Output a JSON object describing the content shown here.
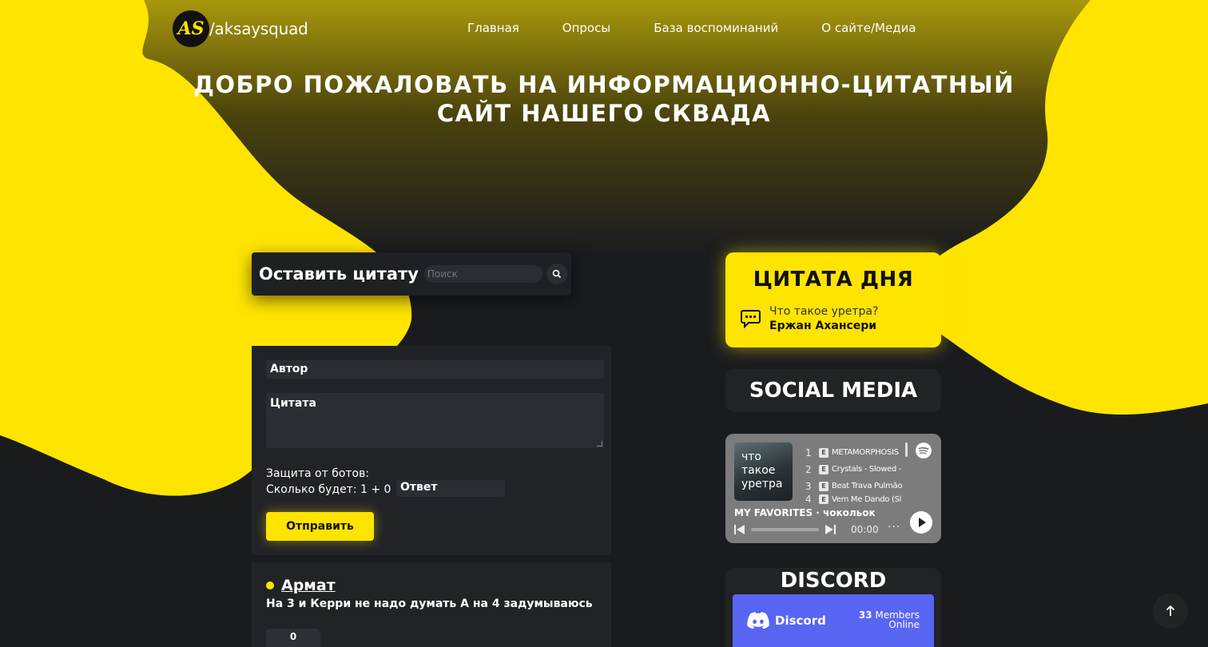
{
  "brand": {
    "logo_mark": "AS",
    "name": "/aksaysquad"
  },
  "nav": {
    "items": [
      {
        "label": "Главная"
      },
      {
        "label": "Опросы"
      },
      {
        "label": "База воспоминаний"
      },
      {
        "label": "О сайте/Медиа"
      }
    ]
  },
  "hero": {
    "title_line1": "ДОБРО ПОЖАЛОВАТЬ НА ИНФОРМАЦИОННО-ЦИТАТНЫЙ",
    "title_line2": "САЙТ НАШЕГО СКВАДА"
  },
  "quote_form": {
    "title": "Оставить цитату",
    "search_placeholder": "Поиск",
    "author_placeholder": "Автор",
    "quote_placeholder": "Цитата",
    "bot_label_line1": "Защита от ботов:",
    "bot_label_line2": "Сколько будет: 1 + 0",
    "answer_placeholder": "Ответ",
    "submit_label": "Отправить"
  },
  "quote_card": {
    "author": "Армат",
    "text": "На 3 и Керри не надо думать А на 4 задумываюсь",
    "votes": "0"
  },
  "quote_of_day": {
    "title": "ЦИТАТА ДНЯ",
    "text": "Что такое уретра?",
    "author": "Ержан Ахансери",
    "icon": "chat-dots-icon"
  },
  "social": {
    "title": "SOCIAL MEDIA"
  },
  "spotify": {
    "cover_text": "что\nтакое\nуретра",
    "tracks": [
      {
        "num": "1",
        "title": "METAMORPHOSIS"
      },
      {
        "num": "2",
        "title": "Crystals - Slowed -"
      },
      {
        "num": "3",
        "title": "Beat Trava Pulmão"
      },
      {
        "num": "4",
        "title": "Vem Me Dando (Sl"
      }
    ],
    "explicit_badge": "E",
    "playlist_title": "MY FAVORITES · чокольок",
    "time": "00:00",
    "more": "···"
  },
  "discord": {
    "title": "DISCORD",
    "widget_name": "Discord",
    "members_count": "33",
    "members_label": "Members",
    "online_label": "Online"
  },
  "colors": {
    "accent": "#ffe400",
    "dark": "#1a1b1f",
    "panel": "#222327",
    "discord": "#5865f2"
  }
}
